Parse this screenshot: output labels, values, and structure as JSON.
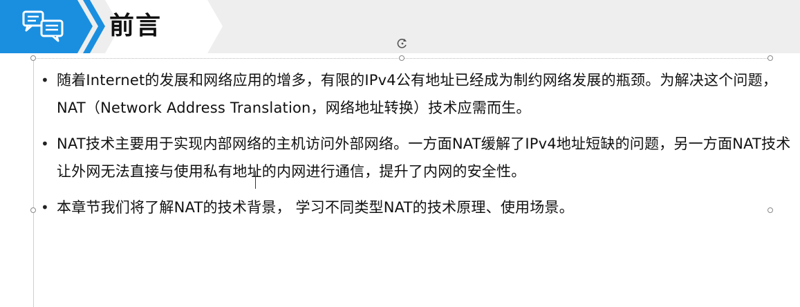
{
  "header": {
    "title": "前言",
    "icon": "chat-bubbles-icon",
    "colors": {
      "accent": "#1a8fe0",
      "band": "#eeeeee"
    }
  },
  "bullets": [
    {
      "text": "随着Internet的发展和网络应用的增多，有限的IPv4公有地址已经成为制约网络发展的瓶颈。为解决这个问题，NAT（Network Address Translation，网络地址转换）技术应需而生。"
    },
    {
      "text": "NAT技术主要用于实现内部网络的主机访问外部网络。一方面NAT缓解了IPv4地址短缺的问题，另一方面NAT技术让外网无法直接与使用私有地址的内网进行通信，提升了内网的安全性。"
    },
    {
      "text": "本章节我们将了解NAT的技术背景， 学习不同类型NAT的技术原理、使用场景。"
    }
  ]
}
